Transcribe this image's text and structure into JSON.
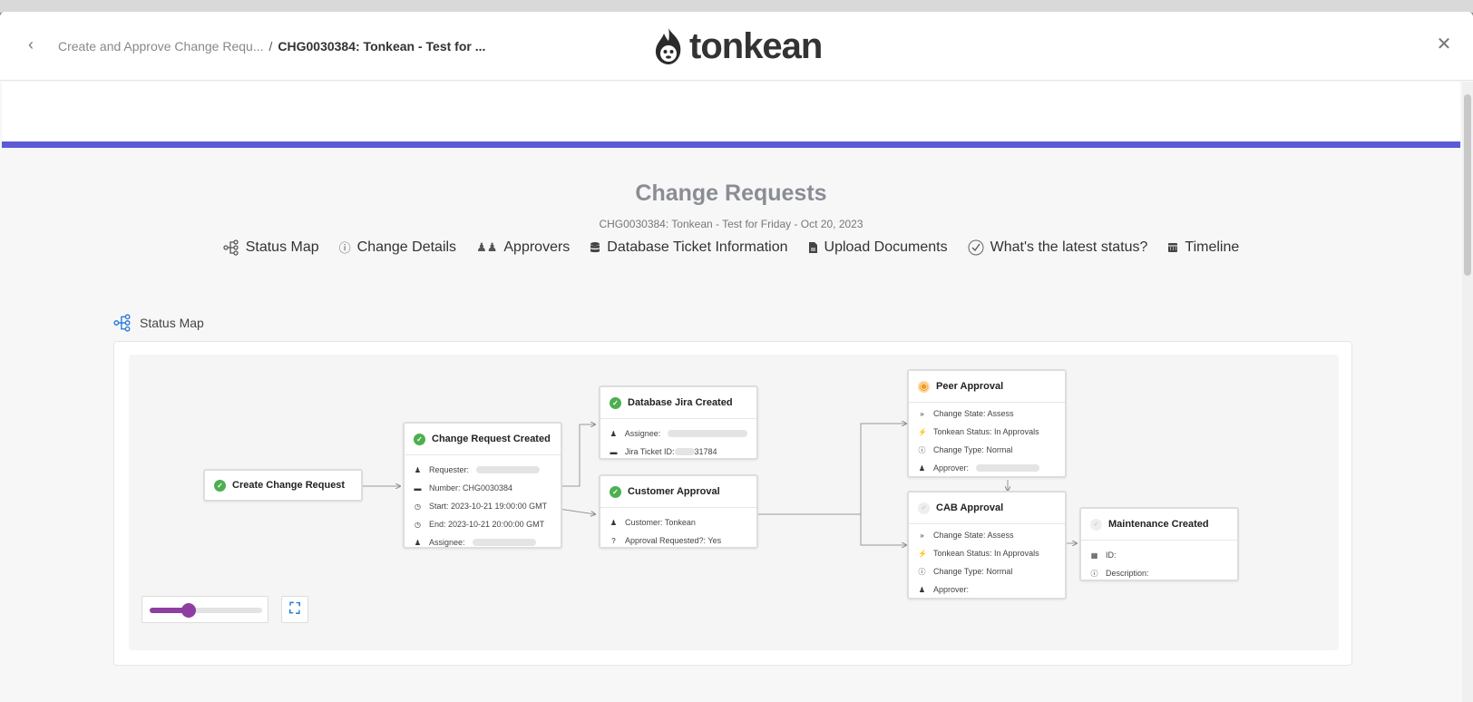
{
  "breadcrumb": {
    "parent": "Create and Approve Change Requ...",
    "separator": "/",
    "current": "CHG0030384: Tonkean - Test for ..."
  },
  "logo": {
    "text": "tonkean"
  },
  "page": {
    "title": "Change Requests",
    "subtitle": "CHG0030384: Tonkean - Test for Friday - Oct 20, 2023"
  },
  "nav": [
    {
      "label": "Status Map",
      "icon": "status-map-icon"
    },
    {
      "label": "Change Details",
      "icon": "info-icon"
    },
    {
      "label": "Approvers",
      "icon": "people-icon"
    },
    {
      "label": "Database Ticket Information",
      "icon": "database-icon"
    },
    {
      "label": "Upload Documents",
      "icon": "document-icon"
    },
    {
      "label": "What's the latest status?",
      "icon": "check-circle-icon"
    },
    {
      "label": "Timeline",
      "icon": "calendar-icon"
    }
  ],
  "section": {
    "title": "Status Map"
  },
  "nodes": {
    "create": {
      "title": "Create Change Request",
      "status": "done"
    },
    "created": {
      "title": "Change Request Created",
      "status": "done",
      "rows": [
        "Requester: ",
        "Number: CHG0030384",
        "Start: 2023-10-21 19:00:00 GMT",
        "End: 2023-10-21 20:00:00 GMT",
        "Assignee: "
      ]
    },
    "jira": {
      "title": "Database Jira Created",
      "status": "done",
      "rows": [
        "Assignee: ",
        "Jira Ticket ID: ",
        "31784"
      ]
    },
    "customer": {
      "title": "Customer Approval",
      "status": "done",
      "rows": [
        "Customer: Tonkean",
        "Approval Requested?: Yes"
      ]
    },
    "peer": {
      "title": "Peer Approval",
      "status": "in-progress",
      "rows": [
        "Change State: Assess",
        "Tonkean Status: In Approvals",
        "Change Type: Normal",
        "Approver: "
      ]
    },
    "cab": {
      "title": "CAB Approval",
      "status": "pending",
      "rows": [
        "Change State: Assess",
        "Tonkean Status: In Approvals",
        "Change Type: Normal",
        "Approver:"
      ]
    },
    "maintenance": {
      "title": "Maintenance Created",
      "status": "pending",
      "rows": [
        "ID:",
        "Description:"
      ]
    }
  },
  "zoom": {
    "level": 0.35
  },
  "colors": {
    "accent": "#5b5bd6",
    "success": "#4caf50",
    "slider": "#8e3ea1",
    "link": "#2f7fd8"
  }
}
